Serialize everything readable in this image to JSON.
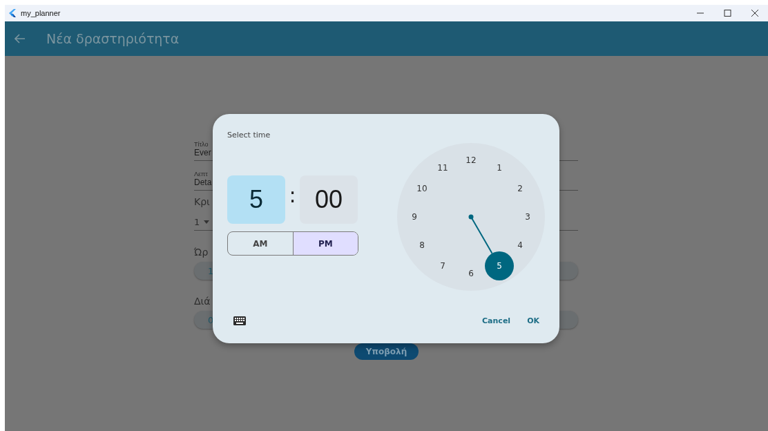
{
  "window": {
    "title": "my_planner"
  },
  "app_bar": {
    "title": "Νέα δραστηριότητα"
  },
  "form": [
    {
      "kind": "text",
      "label": "Τίτλο",
      "value": "Ever"
    },
    {
      "kind": "text",
      "label": "Λεπτ",
      "value": "Deta"
    },
    {
      "kind": "dropdown",
      "label": "Κρι",
      "value": "1"
    },
    {
      "kind": "button",
      "label": "Ώρ",
      "value": "1"
    },
    {
      "kind": "button",
      "label": "Διά",
      "value": "0"
    }
  ],
  "submit_button": "Υποβολή",
  "time_picker": {
    "title": "Select time",
    "separator": ":",
    "fields": [
      {
        "value": "5",
        "selected": true
      },
      {
        "value": "00",
        "selected": false
      }
    ],
    "period": [
      {
        "label": "AM",
        "selected": false
      },
      {
        "label": "PM",
        "selected": true
      }
    ],
    "dial": [
      {
        "label": "12",
        "selected": false
      },
      {
        "label": "1",
        "selected": false
      },
      {
        "label": "2",
        "selected": false
      },
      {
        "label": "3",
        "selected": false
      },
      {
        "label": "4",
        "selected": false
      },
      {
        "label": "5",
        "selected": true
      },
      {
        "label": "6",
        "selected": false
      },
      {
        "label": "7",
        "selected": false
      },
      {
        "label": "8",
        "selected": false
      },
      {
        "label": "9",
        "selected": false
      },
      {
        "label": "10",
        "selected": false
      },
      {
        "label": "11",
        "selected": false
      }
    ],
    "actions": [
      {
        "label": "Cancel"
      },
      {
        "label": "OK"
      }
    ]
  }
}
